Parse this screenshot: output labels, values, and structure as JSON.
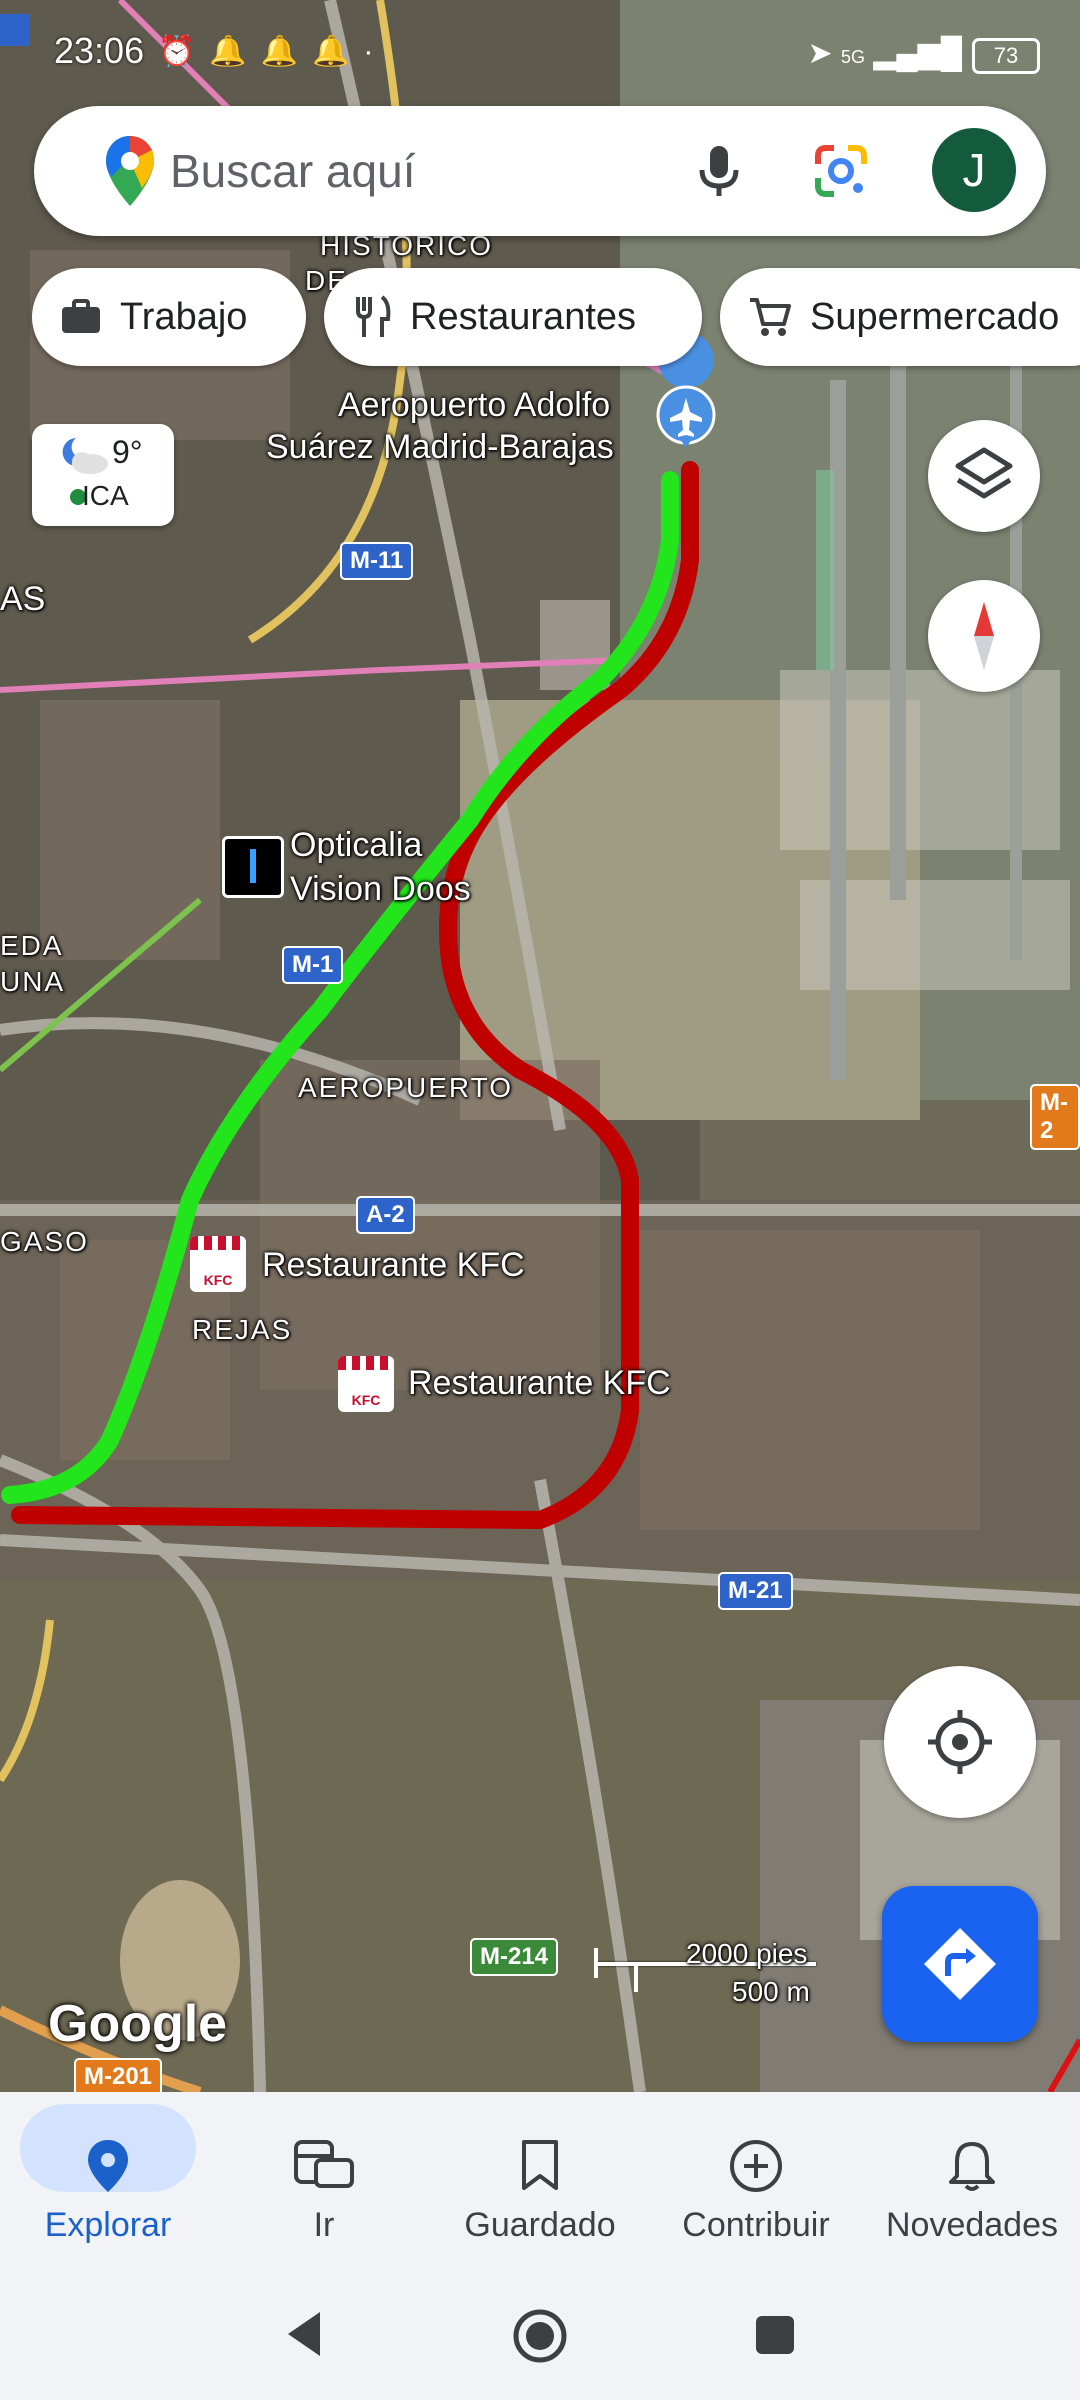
{
  "status_bar": {
    "time": "23:06",
    "network": "5G",
    "battery": "73"
  },
  "search": {
    "placeholder": "Buscar aquí",
    "avatar_letter": "J"
  },
  "chips": [
    {
      "label": "Trabajo",
      "icon": "briefcase-icon"
    },
    {
      "label": "Restaurantes",
      "icon": "fork-knife-icon"
    },
    {
      "label": "Supermercado",
      "icon": "cart-icon"
    }
  ],
  "weather": {
    "temp": "9°",
    "air_quality": "ICA"
  },
  "map_labels": {
    "historico": "HISTORICO",
    "historico_cut": "DE",
    "airport_line1": "Aeropuerto Adolfo",
    "airport_line2": "Suárez Madrid-Barajas",
    "as_cut": "AS",
    "optica_line1": "Opticalia",
    "optica_line2": "Vision Doos",
    "eda_cut": "EDA",
    "una_cut": "UNA",
    "aeropuerto": "AEROPUERTO",
    "gaso_cut": "GASO",
    "kfc1": "Restaurante KFC",
    "rejas": "REJAS",
    "kfc2": "Restaurante KFC",
    "google": "Google",
    "kfc_logo": "KFC"
  },
  "road_shields": {
    "m11": "M-11",
    "m1_cut": "M-1",
    "a2": "A-2",
    "m21": "M-21",
    "m21_right": "M-2",
    "m214": "M-214",
    "m201": "M-201"
  },
  "scale": {
    "imperial": "2000 pies",
    "metric": "500 m"
  },
  "routes": [
    {
      "color": "#22e51c"
    },
    {
      "color": "#c00000"
    }
  ],
  "bottom_nav": [
    {
      "label": "Explorar",
      "icon": "location-pin-icon",
      "active": true
    },
    {
      "label": "Ir",
      "icon": "commute-icon",
      "active": false
    },
    {
      "label": "Guardado",
      "icon": "bookmark-icon",
      "active": false
    },
    {
      "label": "Contribuir",
      "icon": "add-circle-icon",
      "active": false
    },
    {
      "label": "Novedades",
      "icon": "bell-icon",
      "active": false
    }
  ],
  "colors": {
    "accent": "#1a73e8",
    "directions": "#1a62f0",
    "active_pill": "#d3e3fd"
  }
}
